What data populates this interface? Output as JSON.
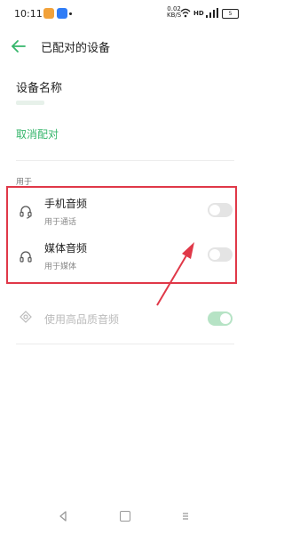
{
  "status_bar": {
    "time": "10:11",
    "network_speed_value": "0.02",
    "network_speed_unit": "KB/S",
    "hd_label": "HD",
    "battery_level": "5"
  },
  "header": {
    "title": "已配对的设备"
  },
  "device_name": {
    "label": "设备名称"
  },
  "unpair_label": "取消配对",
  "section_label": "用于",
  "profiles": [
    {
      "title": "手机音频",
      "subtitle": "用于通话",
      "icon": "headset-icon",
      "enabled": false
    },
    {
      "title": "媒体音频",
      "subtitle": "用于媒体",
      "icon": "headphones-icon",
      "enabled": false
    }
  ],
  "hq_audio": {
    "label": "使用高品质音频",
    "icon": "hq-audio-icon",
    "enabled": true,
    "disabled": true
  },
  "colors": {
    "accent_green": "#36b66b",
    "highlight_red": "#e03848"
  }
}
